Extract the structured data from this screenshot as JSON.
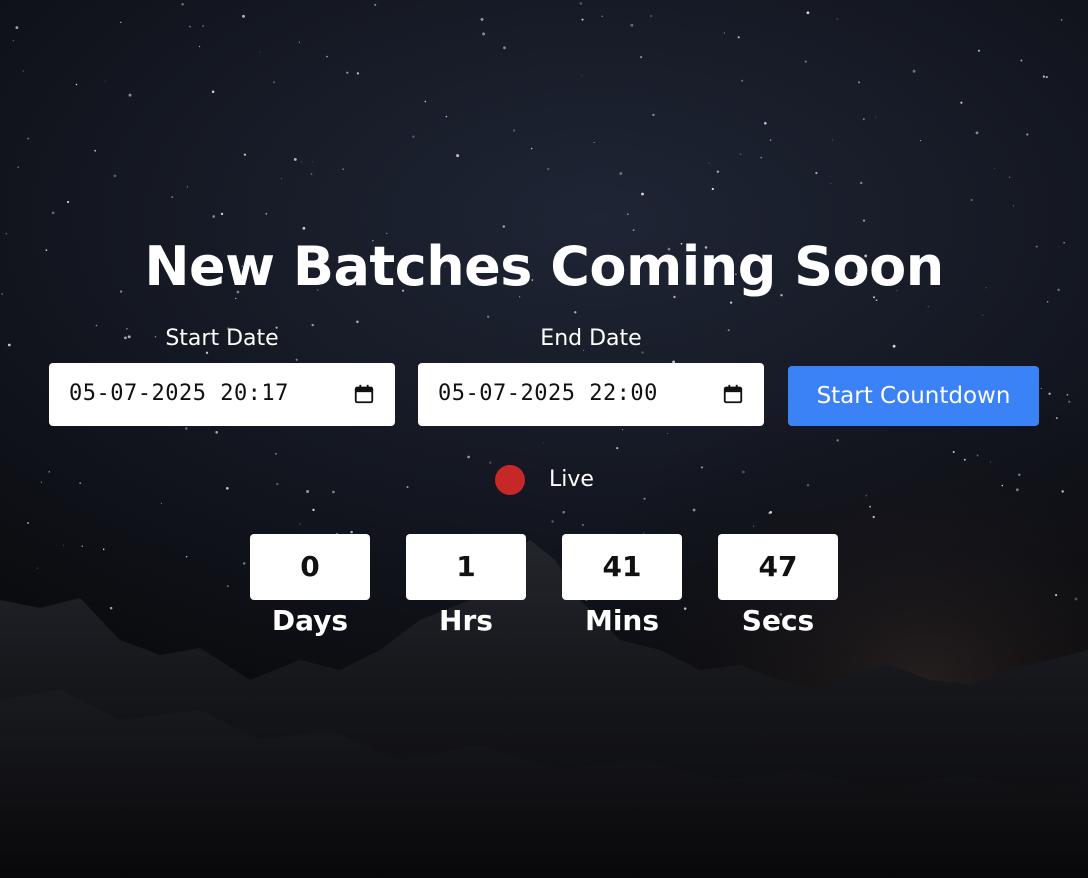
{
  "page": {
    "title": "New Batches Coming Soon"
  },
  "form": {
    "start_label": "Start Date",
    "start_value": "05-07-2025 20:17",
    "end_label": "End Date",
    "end_value": "05-07-2025 22:00",
    "button_label": "Start Countdown",
    "button_color": "#3b82f6"
  },
  "status": {
    "label": "Live",
    "dot_color": "#c62828"
  },
  "countdown": {
    "days": {
      "value": "0",
      "label": "Days"
    },
    "hours": {
      "value": "1",
      "label": "Hrs"
    },
    "minutes": {
      "value": "41",
      "label": "Mins"
    },
    "seconds": {
      "value": "47",
      "label": "Secs"
    }
  },
  "icons": {
    "start_calendar": "calendar-icon",
    "end_calendar": "calendar-icon"
  }
}
